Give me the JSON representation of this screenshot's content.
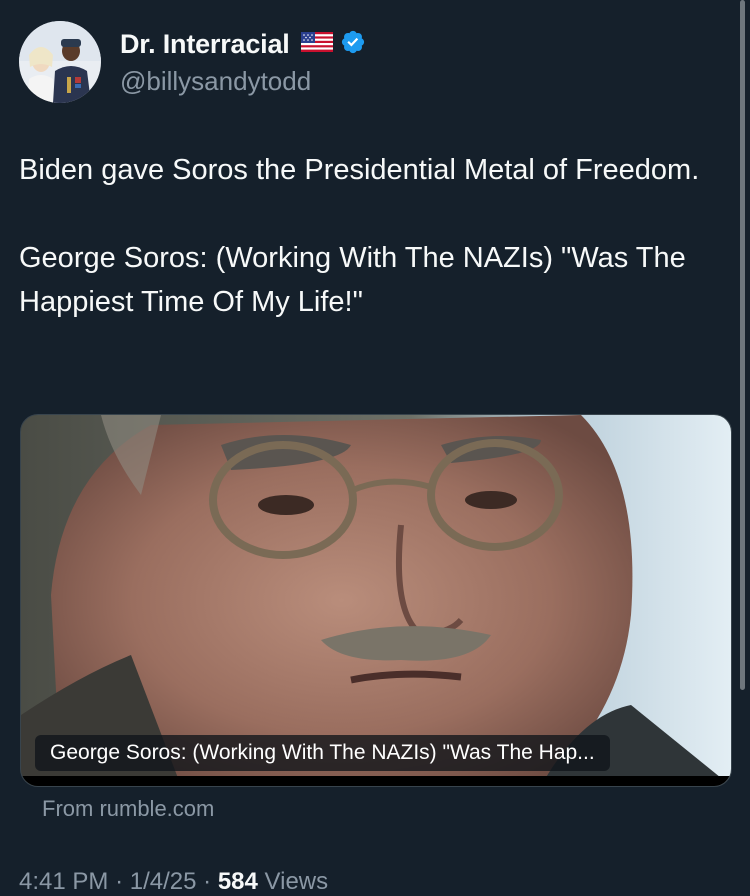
{
  "author": {
    "display_name": "Dr. Interracial",
    "handle": "@billysandytodd",
    "flag": "us-flag-icon",
    "verified": "verified-icon",
    "avatar": "avatar-photo"
  },
  "tweet": {
    "paragraph_1": "Biden gave Soros the Presidential Metal of Freedom.",
    "paragraph_2": "George Soros: (Working With The NAZIs) \"Was The Happiest Time Of My Life!\""
  },
  "media": {
    "caption": "George Soros: (Working With The NAZIs) \"Was The Hap...",
    "source": "From rumble.com"
  },
  "meta": {
    "time": "4:41 PM",
    "separator": "·",
    "date": "1/4/25",
    "views_count": "584",
    "views_label": "Views"
  },
  "colors": {
    "background": "#15202b",
    "text_primary": "#f7f9f9",
    "text_secondary": "#8b98a5",
    "verified_blue": "#1d9bf0",
    "card_border": "#38444d"
  }
}
